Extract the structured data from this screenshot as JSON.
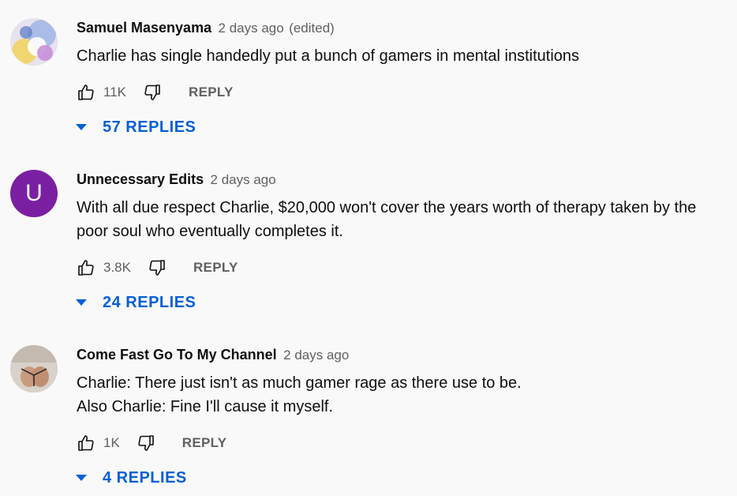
{
  "comments": [
    {
      "author": "Samuel Masenyama",
      "time": "2 days ago",
      "edited": "(edited)",
      "lines": [
        "Charlie has single handedly put a bunch of gamers in mental institutions"
      ],
      "likes": "11K",
      "reply_label": "REPLY",
      "replies_label": "57 REPLIES",
      "avatar_icon": "abstract-photo-avatar"
    },
    {
      "author": "Unnecessary Edits",
      "time": "2 days ago",
      "avatar_letter": "U",
      "avatar_color": "#7b1fa2",
      "lines": [
        "With all due respect Charlie, $20,000 won't cover the years worth of therapy taken by the",
        "poor soul who eventually completes it."
      ],
      "likes": "3.8K",
      "reply_label": "REPLY",
      "replies_label": "24 REPLIES"
    },
    {
      "author": "Come Fast Go To My Channel",
      "time": "2 days ago",
      "lines": [
        "Charlie: There just isn't as much gamer rage as there use to be.",
        "Also Charlie: Fine I'll cause it myself."
      ],
      "likes": "1K",
      "reply_label": "REPLY",
      "replies_label": "4 REPLIES",
      "avatar_icon": "photo-avatar"
    }
  ],
  "colors": {
    "background": "#f9f9f9",
    "text": "#0f0f0f",
    "secondary_text": "#606060",
    "link_blue": "#065fd4"
  }
}
